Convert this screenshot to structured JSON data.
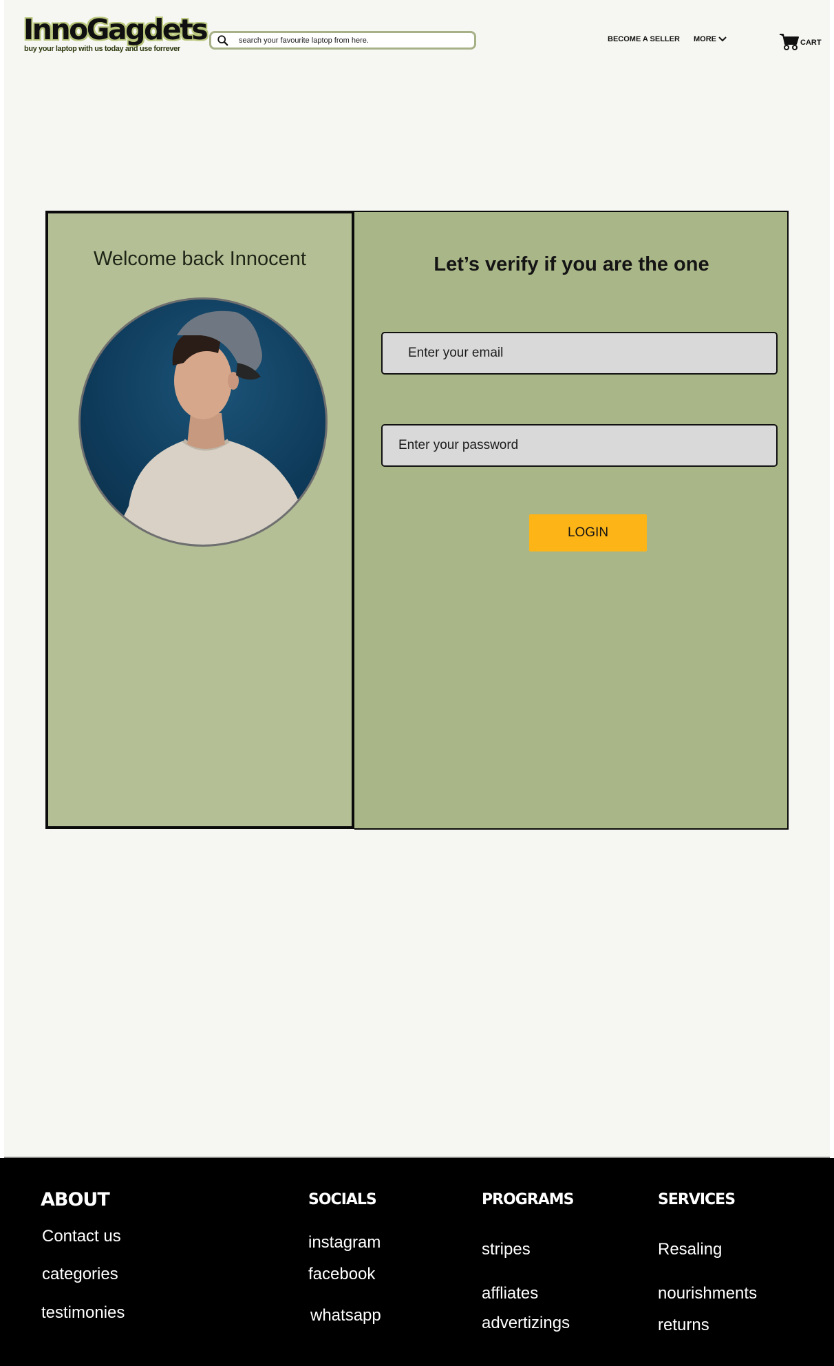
{
  "header": {
    "logo_title": "InnoGagdets",
    "logo_tagline": "buy your laptop with us  today and use forrever",
    "search_placeholder": "search your favourite laptop from here.",
    "nav_become_seller": "BECOME A SELLER",
    "nav_more": "MORE",
    "nav_cart": "CART"
  },
  "login_card": {
    "welcome": "Welcome back Innocent",
    "title": "Let’s  verify if  you are the one",
    "email_placeholder": "Enter your email",
    "password_placeholder": "Enter your password",
    "login_label": "LOGIN"
  },
  "colors": {
    "left_panel": "#b4bf96",
    "right_panel": "#a9b688",
    "login_button": "#fdb417",
    "footer": "#000000",
    "page_background": "#f6f7f2"
  },
  "footer": {
    "about": {
      "heading": "ABOUT",
      "links": [
        "Contact us",
        "categories",
        "testimonies"
      ]
    },
    "socials": {
      "heading": "SOCIALS",
      "links": [
        "instagram",
        "facebook",
        "whatsapp"
      ]
    },
    "programs": {
      "heading": "PROGRAMS",
      "links": [
        "stripes",
        "affliates",
        "advertizings"
      ]
    },
    "services": {
      "heading": "SERVICES",
      "links": [
        "Resaling",
        "nourishments",
        "returns"
      ]
    }
  }
}
